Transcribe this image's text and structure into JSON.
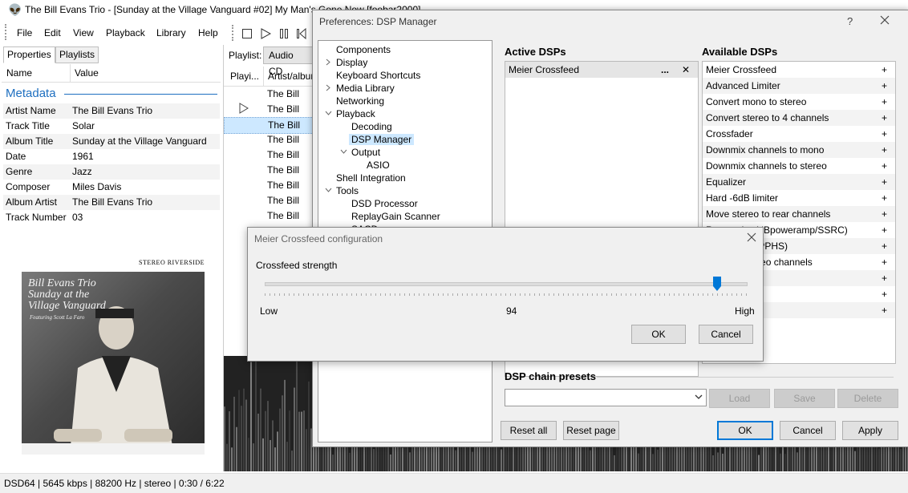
{
  "main_window": {
    "title": "The Bill Evans Trio - [Sunday at the Village Vanguard #02] My Man's Gone Now [foobar2000]",
    "menu": [
      "File",
      "Edit",
      "View",
      "Playback",
      "Library",
      "Help"
    ],
    "left_tabs": [
      "Properties",
      "Playlists"
    ],
    "properties_header": {
      "name": "Name",
      "value": "Value"
    },
    "metadata_heading": "Metadata",
    "properties": [
      {
        "name": "Artist Name",
        "value": "The Bill Evans Trio"
      },
      {
        "name": "Track Title",
        "value": "Solar"
      },
      {
        "name": "Album Title",
        "value": "Sunday at the Village Vanguard"
      },
      {
        "name": "Date",
        "value": "1961"
      },
      {
        "name": "Genre",
        "value": "Jazz"
      },
      {
        "name": "Composer",
        "value": "Miles Davis"
      },
      {
        "name": "Album Artist",
        "value": "The Bill Evans Trio"
      },
      {
        "name": "Track Number",
        "value": "03"
      }
    ],
    "album_art": {
      "header": "STEREO RIVERSIDE",
      "title_lines": [
        "Bill Evans Trio",
        "Sunday at the",
        "Village Vanguard"
      ],
      "subtitle": "Featuring Scott La Faro"
    },
    "playlist_label": "Playlist:",
    "playlist_tab": "Audio CD",
    "playlist_columns": [
      "Playi...",
      "Artist/album"
    ],
    "playlist_rows": [
      "The Bill Evans",
      "The Bill Evans",
      "The Bill Evans",
      "The Bill Evans",
      "The Bill Evans",
      "The Bill Evans",
      "The Bill Evans",
      "The Bill Evans",
      "The Bill Evans"
    ],
    "status_bar": "DSD64 | 5645 kbps | 88200 Hz | stereo | 0:30 / 6:22"
  },
  "preferences": {
    "title": "Preferences: DSP Manager",
    "help_glyph": "?",
    "tree": [
      {
        "label": "Components",
        "level": 0,
        "arrow": ""
      },
      {
        "label": "Display",
        "level": 0,
        "arrow": ">"
      },
      {
        "label": "Keyboard Shortcuts",
        "level": 0,
        "arrow": ""
      },
      {
        "label": "Media Library",
        "level": 0,
        "arrow": ">"
      },
      {
        "label": "Networking",
        "level": 0,
        "arrow": ""
      },
      {
        "label": "Playback",
        "level": 0,
        "arrow": "v"
      },
      {
        "label": "Decoding",
        "level": 1,
        "arrow": ""
      },
      {
        "label": "DSP Manager",
        "level": 1,
        "arrow": "",
        "selected": true
      },
      {
        "label": "Output",
        "level": 1,
        "arrow": "v"
      },
      {
        "label": "ASIO",
        "level": 2,
        "arrow": ""
      },
      {
        "label": "Shell Integration",
        "level": 0,
        "arrow": ""
      },
      {
        "label": "Tools",
        "level": 0,
        "arrow": "v"
      },
      {
        "label": "DSD Processor",
        "level": 1,
        "arrow": ""
      },
      {
        "label": "ReplayGain Scanner",
        "level": 1,
        "arrow": ""
      },
      {
        "label": "SACD",
        "level": 1,
        "arrow": ""
      }
    ],
    "active_heading": "Active DSPs",
    "active_dsps": [
      {
        "label": "Meier Crossfeed",
        "more": "...",
        "remove": "✕"
      }
    ],
    "available_heading": "Available DSPs",
    "available_dsps": [
      "Meier Crossfeed",
      "Advanced Limiter",
      "Convert mono to stereo",
      "Convert stereo to 4 channels",
      "Crossfader",
      "Downmix channels to mono",
      "Downmix channels to stereo",
      "Equalizer",
      "Hard -6dB limiter",
      "Move stereo to rear channels",
      "Resampler (dBpoweramp/SSRC)",
      "Resampler (PPHS)",
      "Reverse stereo channels",
      "",
      "",
      ""
    ],
    "add_glyph": "+",
    "presets_heading": "DSP chain presets",
    "presets_buttons": {
      "load": "Load",
      "save": "Save",
      "delete": "Delete"
    },
    "bottom_buttons": {
      "reset_all": "Reset all",
      "reset_page": "Reset page",
      "ok": "OK",
      "cancel": "Cancel",
      "apply": "Apply"
    }
  },
  "crossfeed_dialog": {
    "title": "Meier Crossfeed configuration",
    "label": "Crossfeed strength",
    "slider_value": 94,
    "slider_min_label": "Low",
    "slider_value_label": "94",
    "slider_max_label": "High",
    "ok": "OK",
    "cancel": "Cancel"
  },
  "colors": {
    "accent": "#0078d7",
    "selection": "#cde8ff",
    "metadata_heading": "#1e6fc0"
  }
}
